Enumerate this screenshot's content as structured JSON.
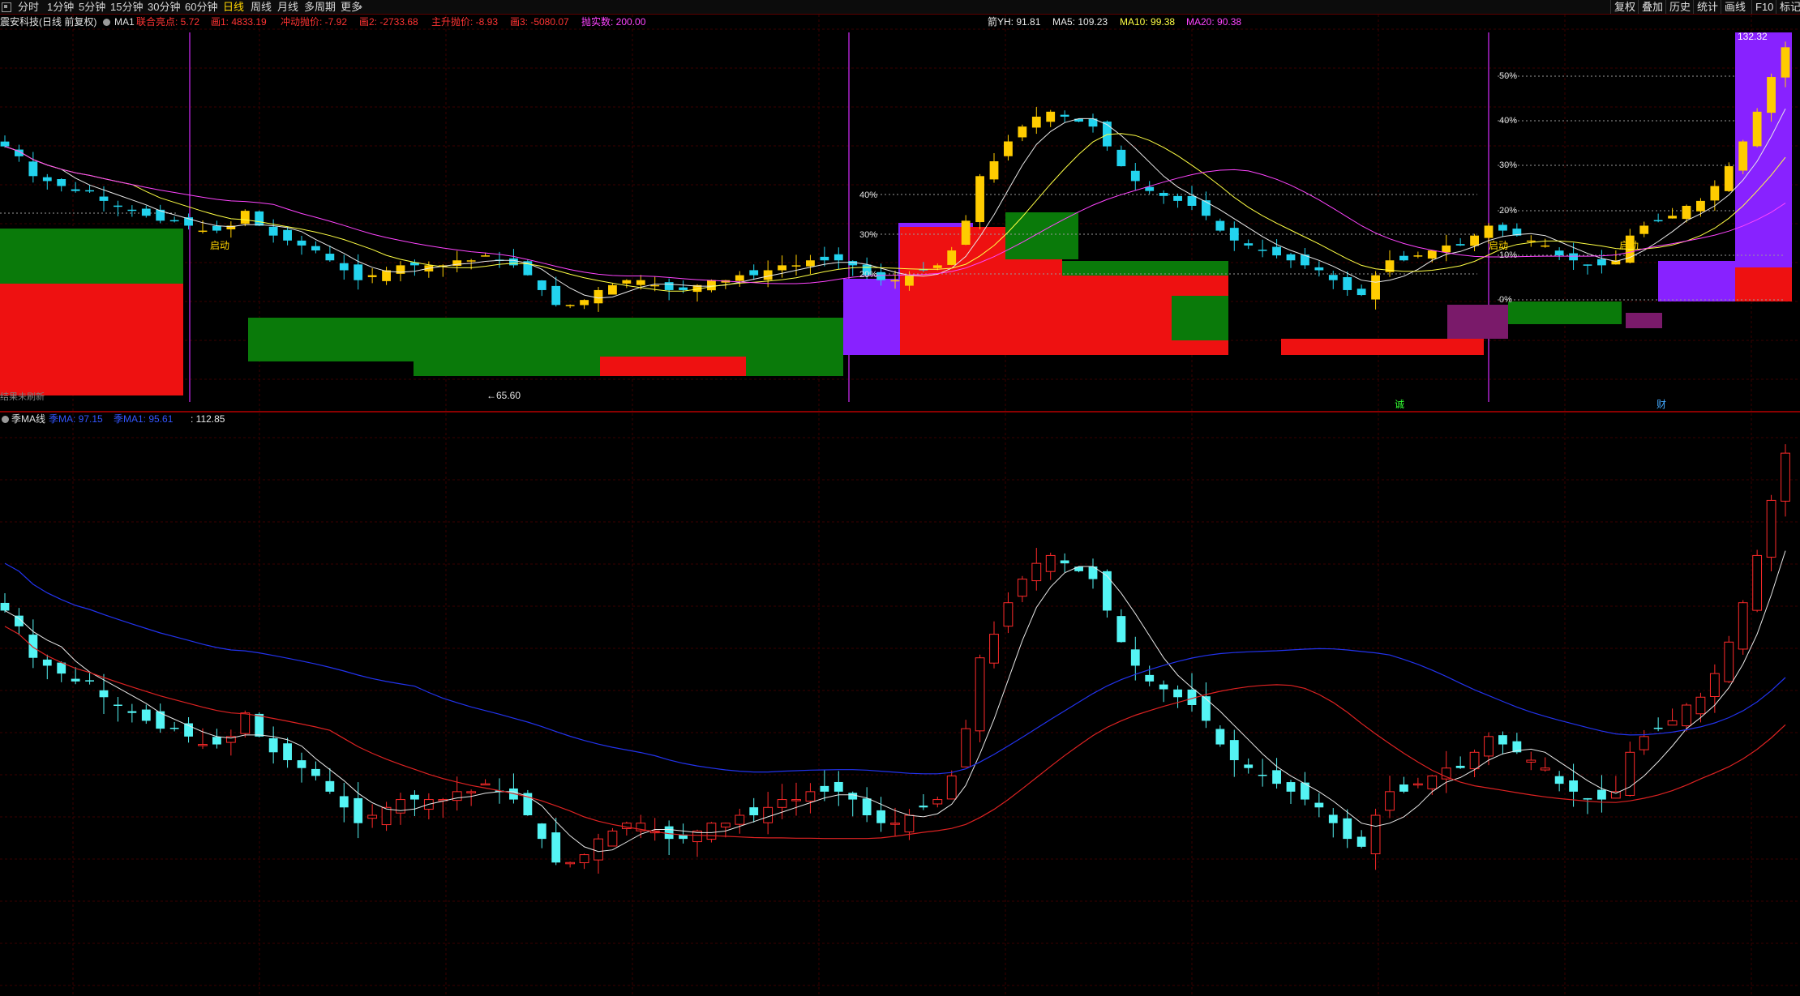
{
  "toolbar": {
    "timeframes": [
      {
        "label": "分时",
        "active": false
      },
      {
        "label": "1分钟",
        "active": false
      },
      {
        "label": "5分钟",
        "active": false
      },
      {
        "label": "15分钟",
        "active": false
      },
      {
        "label": "30分钟",
        "active": false
      },
      {
        "label": "60分钟",
        "active": false
      },
      {
        "label": "日线",
        "active": true
      },
      {
        "label": "周线",
        "active": false
      },
      {
        "label": "月线",
        "active": false
      },
      {
        "label": "多周期",
        "active": false
      },
      {
        "label": "更多",
        "active": false
      }
    ],
    "right_buttons": [
      "复权",
      "叠加",
      "历史",
      "统计",
      "画线",
      "F10",
      "标记"
    ]
  },
  "main_panel": {
    "stock": "震安科技(日线 前复权)",
    "indicator": "MA1",
    "legend": [
      {
        "label": "联合亮点: 5.72",
        "color": "#ff3333"
      },
      {
        "label": "画1: 4833.19",
        "color": "#ff3333"
      },
      {
        "label": "冲动抛价: -7.92",
        "color": "#ff3333"
      },
      {
        "label": "画2: -2733.68",
        "color": "#ff3333"
      },
      {
        "label": "主升抛价: -8.93",
        "color": "#ff3333"
      },
      {
        "label": "画3: -5080.07",
        "color": "#ff3333"
      },
      {
        "label": "抛实数: 200.00",
        "color": "#ff44ff"
      }
    ],
    "ma_legend": [
      {
        "label": "箭YH: 91.81",
        "color": "#e8e8e8"
      },
      {
        "label": "MA5: 109.23",
        "color": "#e8e8e8"
      },
      {
        "label": "MA10: 99.38",
        "color": "#ffff44"
      },
      {
        "label": "MA20: 90.38",
        "color": "#ff44ff"
      }
    ],
    "annotations": {
      "qidong": "启动",
      "low_price": "←65.60",
      "high_price": "132.32",
      "cheng": "诚",
      "cai": "财",
      "bottom_left": "结果未刷新"
    },
    "pct_labels_mid": [
      "40%",
      "30%",
      "20%"
    ],
    "pct_labels_right": [
      "50%",
      "40%",
      "30%",
      "20%",
      "10%",
      "0%"
    ]
  },
  "sub_panel": {
    "indicator": "季MA线",
    "legend": [
      {
        "label": "季MA: 97.15",
        "color": "#3355ff"
      },
      {
        "label": "季MA1: 95.61",
        "color": "#3355ff"
      },
      {
        "label": ": 112.85",
        "color": "#e8e8e8"
      }
    ]
  },
  "chart_data": {
    "type": "candlestick",
    "note_values": "daily OHLC estimated from candles; last close ≈132",
    "closes": [
      112,
      110,
      106,
      105,
      104,
      103,
      103,
      101,
      100,
      99,
      98,
      97,
      97,
      96,
      95,
      95,
      96,
      99,
      96,
      94,
      93,
      92,
      91,
      89,
      87,
      85,
      86,
      87,
      88,
      88,
      88,
      88,
      89,
      89,
      90,
      89,
      88,
      86,
      83,
      80,
      80,
      81,
      83,
      84,
      85,
      85,
      84,
      83,
      83,
      84,
      85,
      85,
      86,
      86,
      87,
      88,
      88,
      89,
      89,
      89,
      88,
      86,
      85,
      85,
      86,
      87,
      88,
      91,
      97,
      106,
      109,
      113,
      116,
      118,
      119,
      118,
      117,
      116,
      112,
      108,
      105,
      103,
      102,
      101,
      100,
      98,
      95,
      93,
      92,
      91,
      90,
      89,
      88,
      87,
      85,
      83,
      82,
      86,
      89,
      89,
      90,
      91,
      92,
      92,
      94,
      96,
      95,
      94,
      93,
      92,
      90,
      89,
      88,
      88,
      89,
      94,
      96,
      97,
      98,
      100,
      101,
      104,
      108,
      113,
      119,
      126,
      132
    ]
  }
}
